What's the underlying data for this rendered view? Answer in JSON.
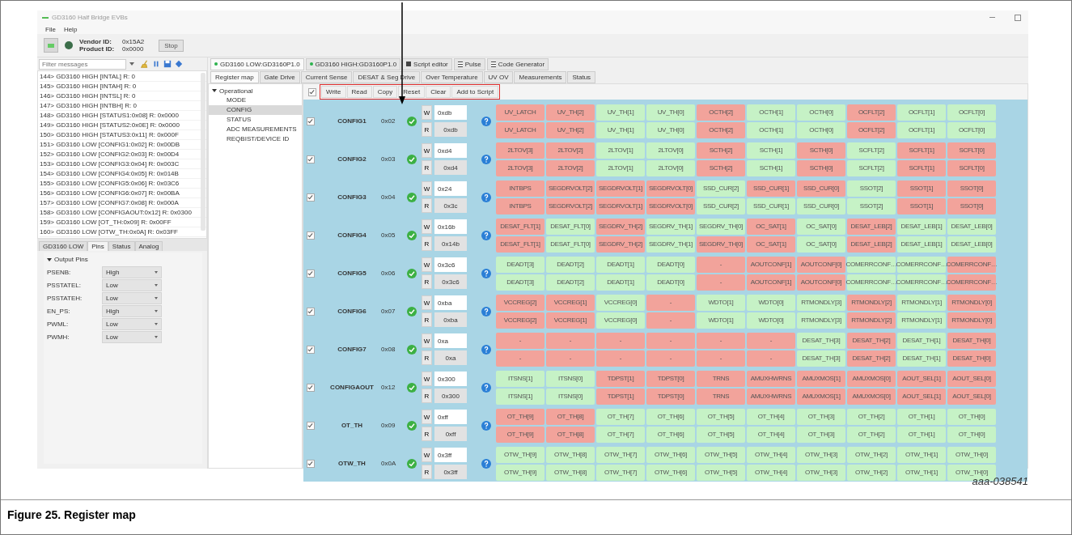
{
  "window": {
    "title": "GD3160 Half Bridge EVBs",
    "menu": [
      "File",
      "Help"
    ]
  },
  "toolbar": {
    "vendor_id_label": "Vendor ID:",
    "vendor_id": "0x15A2",
    "product_id_label": "Product ID:",
    "product_id": "0x0000",
    "stop_button": "Stop"
  },
  "log": {
    "filter_placeholder": "Filter messages",
    "messages": [
      "144> GD3160 HIGH [INTAL] R: 0",
      "145> GD3160 HIGH [INTAH] R: 0",
      "146> GD3160 HIGH [INTSL] R: 0",
      "147> GD3160 HIGH [INTBH] R: 0",
      "148> GD3160 HIGH [STATUS1:0x08] R: 0x0000",
      "149> GD3160 HIGH [STATUS2:0x0E] R: 0x0000",
      "150> GD3160 HIGH [STATUS3:0x11] R: 0x000F",
      "151> GD3160 LOW [CONFIG1:0x02] R: 0x00DB",
      "152> GD3160 LOW [CONFIG2:0x03] R: 0x00D4",
      "153> GD3160 LOW [CONFIG3:0x04] R: 0x003C",
      "154> GD3160 LOW [CONFIG4:0x05] R: 0x014B",
      "155> GD3160 LOW [CONFIG5:0x06] R: 0x03C6",
      "156> GD3160 LOW [CONFIG6:0x07] R: 0x00BA",
      "157> GD3160 LOW [CONFIG7:0x08] R: 0x000A",
      "158> GD3160 LOW [CONFIGAOUT:0x12] R: 0x0300",
      "159> GD3160 LOW [OT_TH:0x09] R: 0x00FF",
      "160> GD3160 LOW [OTW_TH:0x0A] R: 0x03FF"
    ]
  },
  "bottom_tabs": [
    {
      "label": "GD3160 LOW",
      "selected": false
    },
    {
      "label": "Pins",
      "selected": true
    },
    {
      "label": "Status",
      "selected": false
    },
    {
      "label": "Analog",
      "selected": false
    }
  ],
  "output_pins": {
    "title": "Output Pins",
    "expanded": true,
    "pins": [
      {
        "name": "PSENB:",
        "value": "High"
      },
      {
        "name": "PSSTATEL:",
        "value": "Low"
      },
      {
        "name": "PSSTATEH:",
        "value": "Low"
      },
      {
        "name": "EN_PS:",
        "value": "High"
      },
      {
        "name": "PWML:",
        "value": "Low"
      },
      {
        "name": "PWMH:",
        "value": "Low"
      }
    ]
  },
  "device_tabs": [
    {
      "label": "GD3160 LOW:GD3160P1.0",
      "kind": "device",
      "selected": true
    },
    {
      "label": "GD3160 HIGH:GD3160P1.0",
      "kind": "device",
      "selected": false
    },
    {
      "label": "Script editor",
      "kind": "editor",
      "selected": false
    },
    {
      "label": "Pulse",
      "kind": "list",
      "selected": false
    },
    {
      "label": "Code Generator",
      "kind": "list",
      "selected": false
    }
  ],
  "sub_tabs": [
    {
      "label": "Register map",
      "selected": true
    },
    {
      "label": "Gate Drive",
      "selected": false
    },
    {
      "label": "Current Sense",
      "selected": false
    },
    {
      "label": "DESAT & Seg Drive",
      "selected": false
    },
    {
      "label": "Over Temperature",
      "selected": false
    },
    {
      "label": "UV OV",
      "selected": false
    },
    {
      "label": "Measurements",
      "selected": false
    },
    {
      "label": "Status",
      "selected": false
    }
  ],
  "tree": {
    "label": "Operational",
    "expanded": true,
    "children": [
      {
        "label": "MODE",
        "selected": false
      },
      {
        "label": "CONFIG",
        "selected": true
      },
      {
        "label": "STATUS",
        "selected": false
      },
      {
        "label": "ADC MEASUREMENTS",
        "selected": false
      },
      {
        "label": "REQBIST/DEVICE ID",
        "selected": false
      }
    ]
  },
  "actions": {
    "all_checked": true,
    "buttons": [
      "Write",
      "Read",
      "Copy",
      "Reset",
      "Clear",
      "Add to Script"
    ]
  },
  "registers": [
    {
      "name": "CONFIG1",
      "address": "0x02",
      "checked": true,
      "rows": [
        {
          "kind": "write",
          "mode": "W",
          "value": "0xdb",
          "bits": [
            {
              "label": "UV_LATCH",
              "on": false
            },
            {
              "label": "UV_TH[2]",
              "on": false
            },
            {
              "label": "UV_TH[1]",
              "on": true
            },
            {
              "label": "UV_TH[0]",
              "on": true
            },
            {
              "label": "OCTH[2]",
              "on": false
            },
            {
              "label": "OCTH[1]",
              "on": true
            },
            {
              "label": "OCTH[0]",
              "on": true
            },
            {
              "label": "OCFLT[2]",
              "on": false
            },
            {
              "label": "OCFLT[1]",
              "on": true
            },
            {
              "label": "OCFLT[0]",
              "on": true
            }
          ]
        },
        {
          "kind": "read",
          "mode": "R",
          "value": "0xdb",
          "bits": [
            {
              "label": "UV_LATCH",
              "on": false
            },
            {
              "label": "UV_TH[2]",
              "on": false
            },
            {
              "label": "UV_TH[1]",
              "on": true
            },
            {
              "label": "UV_TH[0]",
              "on": true
            },
            {
              "label": "OCTH[2]",
              "on": false
            },
            {
              "label": "OCTH[1]",
              "on": true
            },
            {
              "label": "OCTH[0]",
              "on": true
            },
            {
              "label": "OCFLT[2]",
              "on": false
            },
            {
              "label": "OCFLT[1]",
              "on": true
            },
            {
              "label": "OCFLT[0]",
              "on": true
            }
          ]
        }
      ]
    },
    {
      "name": "CONFIG2",
      "address": "0x03",
      "checked": true,
      "rows": [
        {
          "kind": "write",
          "mode": "W",
          "value": "0xd4",
          "bits": [
            {
              "label": "2LTOV[3]",
              "on": false
            },
            {
              "label": "2LTOV[2]",
              "on": false
            },
            {
              "label": "2LTOV[1]",
              "on": true
            },
            {
              "label": "2LTOV[0]",
              "on": true
            },
            {
              "label": "SCTH[2]",
              "on": false
            },
            {
              "label": "SCTH[1]",
              "on": true
            },
            {
              "label": "SCTH[0]",
              "on": false
            },
            {
              "label": "SCFLT[2]",
              "on": true
            },
            {
              "label": "SCFLT[1]",
              "on": false
            },
            {
              "label": "SCFLT[0]",
              "on": false
            }
          ]
        },
        {
          "kind": "read",
          "mode": "R",
          "value": "0xd4",
          "bits": [
            {
              "label": "2LTOV[3]",
              "on": false
            },
            {
              "label": "2LTOV[2]",
              "on": false
            },
            {
              "label": "2LTOV[1]",
              "on": true
            },
            {
              "label": "2LTOV[0]",
              "on": true
            },
            {
              "label": "SCTH[2]",
              "on": false
            },
            {
              "label": "SCTH[1]",
              "on": true
            },
            {
              "label": "SCTH[0]",
              "on": false
            },
            {
              "label": "SCFLT[2]",
              "on": true
            },
            {
              "label": "SCFLT[1]",
              "on": false
            },
            {
              "label": "SCFLT[0]",
              "on": false
            }
          ]
        }
      ]
    },
    {
      "name": "CONFIG3",
      "address": "0x04",
      "checked": true,
      "rows": [
        {
          "kind": "write",
          "mode": "W",
          "value": "0x24",
          "bits": [
            {
              "label": "INTBPS",
              "on": false
            },
            {
              "label": "SEGDRVOLT[2]",
              "on": false
            },
            {
              "label": "SEGDRVOLT[1]",
              "on": false
            },
            {
              "label": "SEGDRVOLT[0]",
              "on": false
            },
            {
              "label": "SSD_CUR[2]",
              "on": true
            },
            {
              "label": "SSD_CUR[1]",
              "on": false
            },
            {
              "label": "SSD_CUR[0]",
              "on": false
            },
            {
              "label": "SSOT[2]",
              "on": true
            },
            {
              "label": "SSOT[1]",
              "on": false
            },
            {
              "label": "SSOT[0]",
              "on": false
            }
          ]
        },
        {
          "kind": "read",
          "mode": "R",
          "value": "0x3c",
          "bits": [
            {
              "label": "INTBPS",
              "on": false
            },
            {
              "label": "SEGDRVOLT[2]",
              "on": false
            },
            {
              "label": "SEGDRVOLT[1]",
              "on": false
            },
            {
              "label": "SEGDRVOLT[0]",
              "on": false
            },
            {
              "label": "SSD_CUR[2]",
              "on": true
            },
            {
              "label": "SSD_CUR[1]",
              "on": true
            },
            {
              "label": "SSD_CUR[0]",
              "on": true
            },
            {
              "label": "SSOT[2]",
              "on": true
            },
            {
              "label": "SSOT[1]",
              "on": false
            },
            {
              "label": "SSOT[0]",
              "on": false
            }
          ]
        }
      ]
    },
    {
      "name": "CONFIG4",
      "address": "0x05",
      "checked": true,
      "rows": [
        {
          "kind": "write",
          "mode": "W",
          "value": "0x16b",
          "bits": [
            {
              "label": "DESAT_FLT[1]",
              "on": false
            },
            {
              "label": "DESAT_FLT[0]",
              "on": true
            },
            {
              "label": "SEGDRV_TH[2]",
              "on": false
            },
            {
              "label": "SEGDRV_TH[1]",
              "on": true
            },
            {
              "label": "SEGDRV_TH[0]",
              "on": true
            },
            {
              "label": "OC_SAT[1]",
              "on": false
            },
            {
              "label": "OC_SAT[0]",
              "on": true
            },
            {
              "label": "DESAT_LEB[2]",
              "on": false
            },
            {
              "label": "DESAT_LEB[1]",
              "on": true
            },
            {
              "label": "DESAT_LEB[0]",
              "on": true
            }
          ]
        },
        {
          "kind": "read",
          "mode": "R",
          "value": "0x14b",
          "bits": [
            {
              "label": "DESAT_FLT[1]",
              "on": false
            },
            {
              "label": "DESAT_FLT[0]",
              "on": true
            },
            {
              "label": "SEGDRV_TH[2]",
              "on": false
            },
            {
              "label": "SEGDRV_TH[1]",
              "on": true
            },
            {
              "label": "SEGDRV_TH[0]",
              "on": false
            },
            {
              "label": "OC_SAT[1]",
              "on": false
            },
            {
              "label": "OC_SAT[0]",
              "on": true
            },
            {
              "label": "DESAT_LEB[2]",
              "on": false
            },
            {
              "label": "DESAT_LEB[1]",
              "on": true
            },
            {
              "label": "DESAT_LEB[0]",
              "on": true
            }
          ]
        }
      ]
    },
    {
      "name": "CONFIG5",
      "address": "0x06",
      "checked": true,
      "rows": [
        {
          "kind": "write",
          "mode": "W",
          "value": "0x3c6",
          "bits": [
            {
              "label": "DEADT[3]",
              "on": true
            },
            {
              "label": "DEADT[2]",
              "on": true
            },
            {
              "label": "DEADT[1]",
              "on": true
            },
            {
              "label": "DEADT[0]",
              "on": true
            },
            {
              "label": "-",
              "on": false
            },
            {
              "label": "AOUTCONF[1]",
              "on": false
            },
            {
              "label": "AOUTCONF[0]",
              "on": false
            },
            {
              "label": "COMERRCONF…",
              "on": true
            },
            {
              "label": "COMERRCONF…",
              "on": true
            },
            {
              "label": "COMERRCONF…",
              "on": false
            }
          ]
        },
        {
          "kind": "read",
          "mode": "R",
          "value": "0x3c6",
          "bits": [
            {
              "label": "DEADT[3]",
              "on": true
            },
            {
              "label": "DEADT[2]",
              "on": true
            },
            {
              "label": "DEADT[1]",
              "on": true
            },
            {
              "label": "DEADT[0]",
              "on": true
            },
            {
              "label": "-",
              "on": false
            },
            {
              "label": "AOUTCONF[1]",
              "on": false
            },
            {
              "label": "AOUTCONF[0]",
              "on": false
            },
            {
              "label": "COMERRCONF…",
              "on": true
            },
            {
              "label": "COMERRCONF…",
              "on": true
            },
            {
              "label": "COMERRCONF…",
              "on": false
            }
          ]
        }
      ]
    },
    {
      "name": "CONFIG6",
      "address": "0x07",
      "checked": true,
      "rows": [
        {
          "kind": "write",
          "mode": "W",
          "value": "0xba",
          "bits": [
            {
              "label": "VCCREG[2]",
              "on": false
            },
            {
              "label": "VCCREG[1]",
              "on": false
            },
            {
              "label": "VCCREG[0]",
              "on": true
            },
            {
              "label": "-",
              "on": false
            },
            {
              "label": "WDTO[1]",
              "on": true
            },
            {
              "label": "WDTO[0]",
              "on": true
            },
            {
              "label": "RTMONDLY[3]",
              "on": true
            },
            {
              "label": "RTMONDLY[2]",
              "on": false
            },
            {
              "label": "RTMONDLY[1]",
              "on": true
            },
            {
              "label": "RTMONDLY[0]",
              "on": false
            }
          ]
        },
        {
          "kind": "read",
          "mode": "R",
          "value": "0xba",
          "bits": [
            {
              "label": "VCCREG[2]",
              "on": false
            },
            {
              "label": "VCCREG[1]",
              "on": false
            },
            {
              "label": "VCCREG[0]",
              "on": true
            },
            {
              "label": "-",
              "on": false
            },
            {
              "label": "WDTO[1]",
              "on": true
            },
            {
              "label": "WDTO[0]",
              "on": true
            },
            {
              "label": "RTMONDLY[3]",
              "on": true
            },
            {
              "label": "RTMONDLY[2]",
              "on": false
            },
            {
              "label": "RTMONDLY[1]",
              "on": true
            },
            {
              "label": "RTMONDLY[0]",
              "on": false
            }
          ]
        }
      ]
    },
    {
      "name": "CONFIG7",
      "address": "0x08",
      "checked": true,
      "rows": [
        {
          "kind": "write",
          "mode": "W",
          "value": "0xa",
          "bits": [
            {
              "label": "-",
              "on": false
            },
            {
              "label": "-",
              "on": false
            },
            {
              "label": "-",
              "on": false
            },
            {
              "label": "-",
              "on": false
            },
            {
              "label": "-",
              "on": false
            },
            {
              "label": "-",
              "on": false
            },
            {
              "label": "DESAT_TH[3]",
              "on": true
            },
            {
              "label": "DESAT_TH[2]",
              "on": false
            },
            {
              "label": "DESAT_TH[1]",
              "on": true
            },
            {
              "label": "DESAT_TH[0]",
              "on": false
            }
          ]
        },
        {
          "kind": "read",
          "mode": "R",
          "value": "0xa",
          "bits": [
            {
              "label": "-",
              "on": false
            },
            {
              "label": "-",
              "on": false
            },
            {
              "label": "-",
              "on": false
            },
            {
              "label": "-",
              "on": false
            },
            {
              "label": "-",
              "on": false
            },
            {
              "label": "-",
              "on": false
            },
            {
              "label": "DESAT_TH[3]",
              "on": true
            },
            {
              "label": "DESAT_TH[2]",
              "on": false
            },
            {
              "label": "DESAT_TH[1]",
              "on": true
            },
            {
              "label": "DESAT_TH[0]",
              "on": false
            }
          ]
        }
      ]
    },
    {
      "name": "CONFIGAOUT",
      "address": "0x12",
      "checked": true,
      "rows": [
        {
          "kind": "write",
          "mode": "W",
          "value": "0x300",
          "bits": [
            {
              "label": "ITSNS[1]",
              "on": true
            },
            {
              "label": "ITSNS[0]",
              "on": true
            },
            {
              "label": "TDPST[1]",
              "on": false
            },
            {
              "label": "TDPST[0]",
              "on": false
            },
            {
              "label": "TRNS",
              "on": false
            },
            {
              "label": "AMUXHWRNS",
              "on": false
            },
            {
              "label": "AMUXMOS[1]",
              "on": false
            },
            {
              "label": "AMUXMOS[0]",
              "on": false
            },
            {
              "label": "AOUT_SEL[1]",
              "on": false
            },
            {
              "label": "AOUT_SEL[0]",
              "on": false
            }
          ]
        },
        {
          "kind": "read",
          "mode": "R",
          "value": "0x300",
          "bits": [
            {
              "label": "ITSNS[1]",
              "on": true
            },
            {
              "label": "ITSNS[0]",
              "on": true
            },
            {
              "label": "TDPST[1]",
              "on": false
            },
            {
              "label": "TDPST[0]",
              "on": false
            },
            {
              "label": "TRNS",
              "on": false
            },
            {
              "label": "AMUXHWRNS",
              "on": false
            },
            {
              "label": "AMUXMOS[1]",
              "on": false
            },
            {
              "label": "AMUXMOS[0]",
              "on": false
            },
            {
              "label": "AOUT_SEL[1]",
              "on": false
            },
            {
              "label": "AOUT_SEL[0]",
              "on": false
            }
          ]
        }
      ]
    },
    {
      "name": "OT_TH",
      "address": "0x09",
      "checked": true,
      "rows": [
        {
          "kind": "write",
          "mode": "W",
          "value": "0xff",
          "bits": [
            {
              "label": "OT_TH[9]",
              "on": false
            },
            {
              "label": "OT_TH[8]",
              "on": false
            },
            {
              "label": "OT_TH[7]",
              "on": true
            },
            {
              "label": "OT_TH[6]",
              "on": true
            },
            {
              "label": "OT_TH[5]",
              "on": true
            },
            {
              "label": "OT_TH[4]",
              "on": true
            },
            {
              "label": "OT_TH[3]",
              "on": true
            },
            {
              "label": "OT_TH[2]",
              "on": true
            },
            {
              "label": "OT_TH[1]",
              "on": true
            },
            {
              "label": "OT_TH[0]",
              "on": true
            }
          ]
        },
        {
          "kind": "read",
          "mode": "R",
          "value": "0xff",
          "bits": [
            {
              "label": "OT_TH[9]",
              "on": false
            },
            {
              "label": "OT_TH[8]",
              "on": false
            },
            {
              "label": "OT_TH[7]",
              "on": true
            },
            {
              "label": "OT_TH[6]",
              "on": true
            },
            {
              "label": "OT_TH[5]",
              "on": true
            },
            {
              "label": "OT_TH[4]",
              "on": true
            },
            {
              "label": "OT_TH[3]",
              "on": true
            },
            {
              "label": "OT_TH[2]",
              "on": true
            },
            {
              "label": "OT_TH[1]",
              "on": true
            },
            {
              "label": "OT_TH[0]",
              "on": true
            }
          ]
        }
      ]
    },
    {
      "name": "OTW_TH",
      "address": "0x0A",
      "checked": true,
      "rows": [
        {
          "kind": "write",
          "mode": "W",
          "value": "0x3ff",
          "bits": [
            {
              "label": "OTW_TH[9]",
              "on": true
            },
            {
              "label": "OTW_TH[8]",
              "on": true
            },
            {
              "label": "OTW_TH[7]",
              "on": true
            },
            {
              "label": "OTW_TH[6]",
              "on": true
            },
            {
              "label": "OTW_TH[5]",
              "on": true
            },
            {
              "label": "OTW_TH[4]",
              "on": true
            },
            {
              "label": "OTW_TH[3]",
              "on": true
            },
            {
              "label": "OTW_TH[2]",
              "on": true
            },
            {
              "label": "OTW_TH[1]",
              "on": true
            },
            {
              "label": "OTW_TH[0]",
              "on": true
            }
          ]
        },
        {
          "kind": "read",
          "mode": "R",
          "value": "0x3ff",
          "bits": [
            {
              "label": "OTW_TH[9]",
              "on": true
            },
            {
              "label": "OTW_TH[8]",
              "on": true
            },
            {
              "label": "OTW_TH[7]",
              "on": true
            },
            {
              "label": "OTW_TH[6]",
              "on": true
            },
            {
              "label": "OTW_TH[5]",
              "on": true
            },
            {
              "label": "OTW_TH[4]",
              "on": true
            },
            {
              "label": "OTW_TH[3]",
              "on": true
            },
            {
              "label": "OTW_TH[2]",
              "on": true
            },
            {
              "label": "OTW_TH[1]",
              "on": true
            },
            {
              "label": "OTW_TH[0]",
              "on": true
            }
          ]
        }
      ]
    }
  ],
  "figure": {
    "image_id": "aaa-038541",
    "caption": "Figure 25. Register map"
  }
}
